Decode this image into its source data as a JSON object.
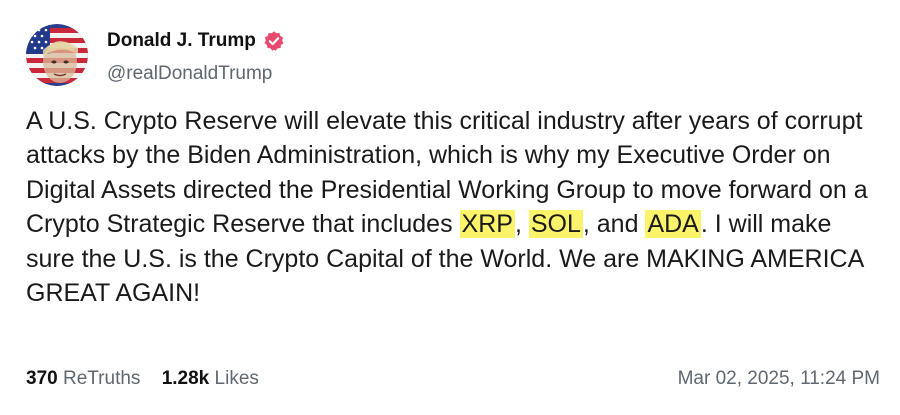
{
  "author": {
    "display_name": "Donald J. Trump",
    "handle": "@realDonaldTrump",
    "verified_icon": "verified-badge-icon",
    "badge_color": "#e94b6f"
  },
  "post": {
    "text_parts": [
      "A U.S. Crypto Reserve will elevate this critical industry after years of corrupt attacks by the Biden Administration, which is why my Executive Order on Digital Assets directed the Presidential Working Group to move forward on a Crypto Strategic Reserve that includes ",
      ", ",
      ", and ",
      ". I will make sure the U.S. is the Crypto Capital of the World. We are MAKING AMERICA GREAT AGAIN!"
    ],
    "highlights": [
      "XRP",
      "SOL",
      "ADA"
    ],
    "highlight_color": "#fbf46b"
  },
  "stats": {
    "retruths_count": "370",
    "retruths_label": "ReTruths",
    "likes_count": "1.28k",
    "likes_label": "Likes",
    "timestamp": "Mar 02, 2025, 11:24 PM"
  }
}
